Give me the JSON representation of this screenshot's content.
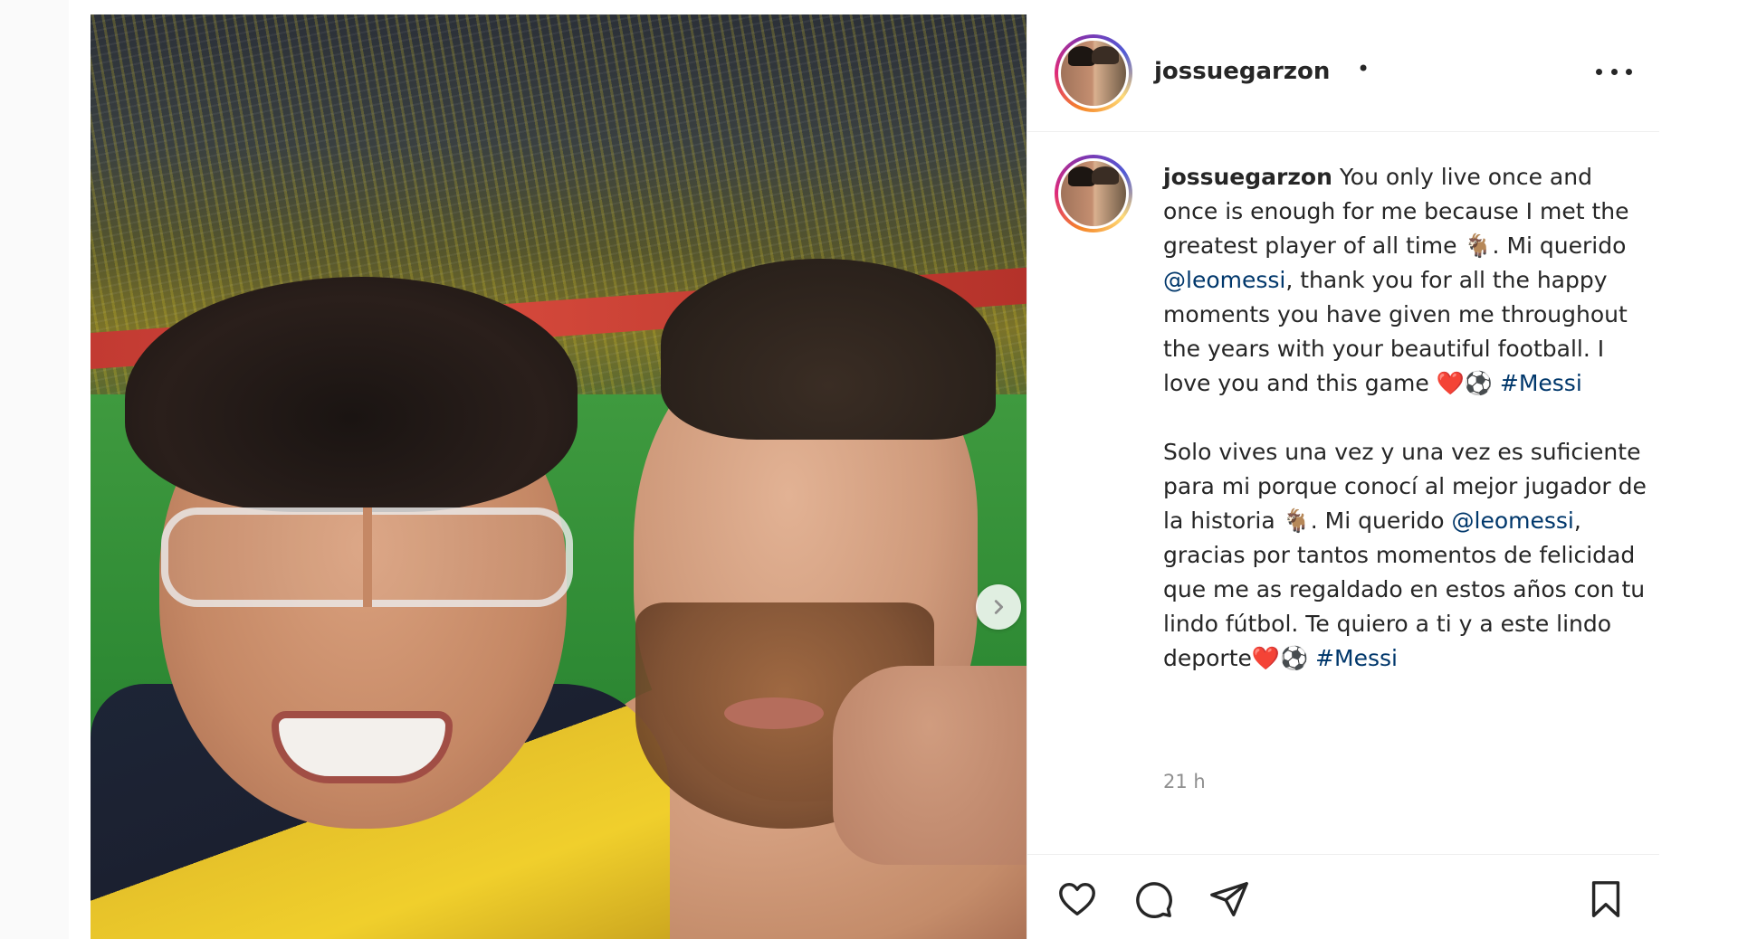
{
  "post": {
    "username": "jossuegarzon",
    "separator": "•",
    "caption": {
      "username": "jossuegarzon",
      "en_text_1": " You only live once and once is enough for me because I met the greatest player of all time 🐐. Mi querido ",
      "mention_1": "@leomessi",
      "en_text_2": ", thank you for all the happy moments you have given me throughout the years with your beautiful football. I love you and this game ❤️⚽ ",
      "hashtag_1": "#Messi",
      "es_text_1": "Solo vives una vez y una vez es suficiente para mi porque conocí al mejor jugador de la historia 🐐. Mi querido ",
      "mention_2": "@leomessi",
      "es_text_2": ", gracias por tantos momentos de felicidad que me as regaldado en estos años con tu lindo fútbol. Te quiero a ti y a este lindo deporte❤️⚽ ",
      "hashtag_2": "#Messi"
    },
    "timestamp": "21 h"
  },
  "icons": {
    "more": "more-options-icon",
    "next": "chevron-right-icon",
    "like": "heart-icon",
    "comment": "comment-icon",
    "share": "paper-plane-icon",
    "save": "bookmark-icon"
  },
  "colors": {
    "link": "#00376b",
    "text": "#262626",
    "muted": "#8e8e8e",
    "divider": "#efefef"
  }
}
